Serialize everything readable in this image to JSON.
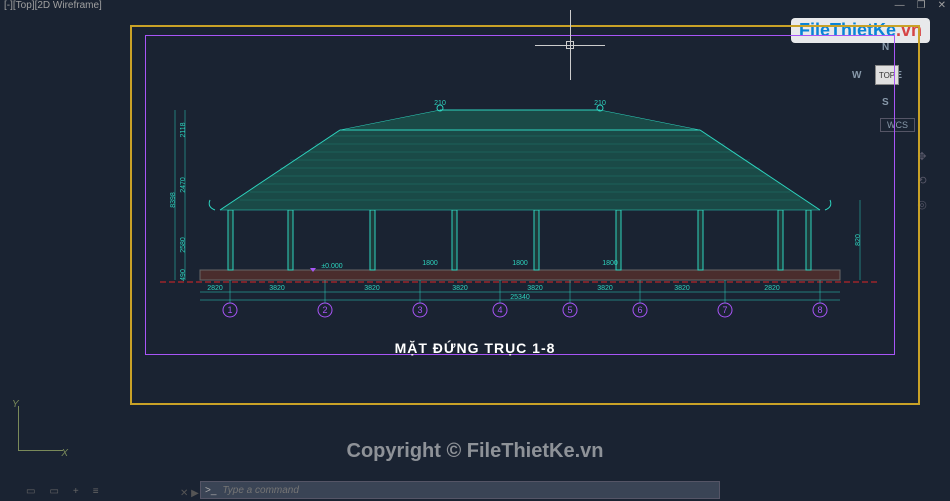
{
  "window": {
    "view_label": "[-][Top][2D Wireframe]",
    "min": "—",
    "restore": "❐",
    "close": "✕"
  },
  "watermark": {
    "logo_prefix": "File",
    "logo_mid": "ThietKe",
    "logo_suffix": ".vn",
    "center_text": "Copyright © FileThietKe.vn"
  },
  "viewcube": {
    "center": "TOP",
    "n": "N",
    "s": "S",
    "e": "E",
    "w": "W"
  },
  "wcs": "WCS",
  "ucs": {
    "x": "X",
    "y": "Y"
  },
  "command": {
    "prompt": ">_",
    "placeholder": "Type a command"
  },
  "tabs": {
    "plus": "+",
    "list": "≡"
  },
  "navbar": {
    "pan": "✥",
    "orbit": "⟲",
    "wheel": "◎"
  },
  "drawing": {
    "title": "MẶT ĐỨNG TRỤC 1-8",
    "grids": [
      "1",
      "2",
      "3",
      "4",
      "5",
      "6",
      "7",
      "8"
    ],
    "grid_spans": [
      "2820",
      "3820",
      "3820",
      "3820",
      "3820",
      "3820",
      "3820",
      "2820"
    ],
    "total_span": "25340",
    "level_zero": "±0.000",
    "openings": [
      "1800",
      "1800",
      "1800"
    ],
    "heights": {
      "h1": "490",
      "h2": "2580",
      "h3": "2470",
      "h4": "2118",
      "total": "8398",
      "right1": "820",
      "ridge_right": "210",
      "ridge_left": "210"
    }
  }
}
